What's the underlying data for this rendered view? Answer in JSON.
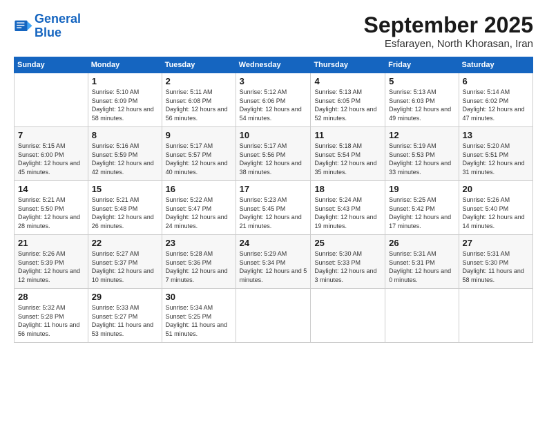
{
  "header": {
    "logo_line1": "General",
    "logo_line2": "Blue",
    "month": "September 2025",
    "location": "Esfarayen, North Khorasan, Iran"
  },
  "days_of_week": [
    "Sunday",
    "Monday",
    "Tuesday",
    "Wednesday",
    "Thursday",
    "Friday",
    "Saturday"
  ],
  "weeks": [
    [
      {
        "num": "",
        "sunrise": "",
        "sunset": "",
        "daylight": ""
      },
      {
        "num": "1",
        "sunrise": "Sunrise: 5:10 AM",
        "sunset": "Sunset: 6:09 PM",
        "daylight": "Daylight: 12 hours and 58 minutes."
      },
      {
        "num": "2",
        "sunrise": "Sunrise: 5:11 AM",
        "sunset": "Sunset: 6:08 PM",
        "daylight": "Daylight: 12 hours and 56 minutes."
      },
      {
        "num": "3",
        "sunrise": "Sunrise: 5:12 AM",
        "sunset": "Sunset: 6:06 PM",
        "daylight": "Daylight: 12 hours and 54 minutes."
      },
      {
        "num": "4",
        "sunrise": "Sunrise: 5:13 AM",
        "sunset": "Sunset: 6:05 PM",
        "daylight": "Daylight: 12 hours and 52 minutes."
      },
      {
        "num": "5",
        "sunrise": "Sunrise: 5:13 AM",
        "sunset": "Sunset: 6:03 PM",
        "daylight": "Daylight: 12 hours and 49 minutes."
      },
      {
        "num": "6",
        "sunrise": "Sunrise: 5:14 AM",
        "sunset": "Sunset: 6:02 PM",
        "daylight": "Daylight: 12 hours and 47 minutes."
      }
    ],
    [
      {
        "num": "7",
        "sunrise": "Sunrise: 5:15 AM",
        "sunset": "Sunset: 6:00 PM",
        "daylight": "Daylight: 12 hours and 45 minutes."
      },
      {
        "num": "8",
        "sunrise": "Sunrise: 5:16 AM",
        "sunset": "Sunset: 5:59 PM",
        "daylight": "Daylight: 12 hours and 42 minutes."
      },
      {
        "num": "9",
        "sunrise": "Sunrise: 5:17 AM",
        "sunset": "Sunset: 5:57 PM",
        "daylight": "Daylight: 12 hours and 40 minutes."
      },
      {
        "num": "10",
        "sunrise": "Sunrise: 5:17 AM",
        "sunset": "Sunset: 5:56 PM",
        "daylight": "Daylight: 12 hours and 38 minutes."
      },
      {
        "num": "11",
        "sunrise": "Sunrise: 5:18 AM",
        "sunset": "Sunset: 5:54 PM",
        "daylight": "Daylight: 12 hours and 35 minutes."
      },
      {
        "num": "12",
        "sunrise": "Sunrise: 5:19 AM",
        "sunset": "Sunset: 5:53 PM",
        "daylight": "Daylight: 12 hours and 33 minutes."
      },
      {
        "num": "13",
        "sunrise": "Sunrise: 5:20 AM",
        "sunset": "Sunset: 5:51 PM",
        "daylight": "Daylight: 12 hours and 31 minutes."
      }
    ],
    [
      {
        "num": "14",
        "sunrise": "Sunrise: 5:21 AM",
        "sunset": "Sunset: 5:50 PM",
        "daylight": "Daylight: 12 hours and 28 minutes."
      },
      {
        "num": "15",
        "sunrise": "Sunrise: 5:21 AM",
        "sunset": "Sunset: 5:48 PM",
        "daylight": "Daylight: 12 hours and 26 minutes."
      },
      {
        "num": "16",
        "sunrise": "Sunrise: 5:22 AM",
        "sunset": "Sunset: 5:47 PM",
        "daylight": "Daylight: 12 hours and 24 minutes."
      },
      {
        "num": "17",
        "sunrise": "Sunrise: 5:23 AM",
        "sunset": "Sunset: 5:45 PM",
        "daylight": "Daylight: 12 hours and 21 minutes."
      },
      {
        "num": "18",
        "sunrise": "Sunrise: 5:24 AM",
        "sunset": "Sunset: 5:43 PM",
        "daylight": "Daylight: 12 hours and 19 minutes."
      },
      {
        "num": "19",
        "sunrise": "Sunrise: 5:25 AM",
        "sunset": "Sunset: 5:42 PM",
        "daylight": "Daylight: 12 hours and 17 minutes."
      },
      {
        "num": "20",
        "sunrise": "Sunrise: 5:26 AM",
        "sunset": "Sunset: 5:40 PM",
        "daylight": "Daylight: 12 hours and 14 minutes."
      }
    ],
    [
      {
        "num": "21",
        "sunrise": "Sunrise: 5:26 AM",
        "sunset": "Sunset: 5:39 PM",
        "daylight": "Daylight: 12 hours and 12 minutes."
      },
      {
        "num": "22",
        "sunrise": "Sunrise: 5:27 AM",
        "sunset": "Sunset: 5:37 PM",
        "daylight": "Daylight: 12 hours and 10 minutes."
      },
      {
        "num": "23",
        "sunrise": "Sunrise: 5:28 AM",
        "sunset": "Sunset: 5:36 PM",
        "daylight": "Daylight: 12 hours and 7 minutes."
      },
      {
        "num": "24",
        "sunrise": "Sunrise: 5:29 AM",
        "sunset": "Sunset: 5:34 PM",
        "daylight": "Daylight: 12 hours and 5 minutes."
      },
      {
        "num": "25",
        "sunrise": "Sunrise: 5:30 AM",
        "sunset": "Sunset: 5:33 PM",
        "daylight": "Daylight: 12 hours and 3 minutes."
      },
      {
        "num": "26",
        "sunrise": "Sunrise: 5:31 AM",
        "sunset": "Sunset: 5:31 PM",
        "daylight": "Daylight: 12 hours and 0 minutes."
      },
      {
        "num": "27",
        "sunrise": "Sunrise: 5:31 AM",
        "sunset": "Sunset: 5:30 PM",
        "daylight": "Daylight: 11 hours and 58 minutes."
      }
    ],
    [
      {
        "num": "28",
        "sunrise": "Sunrise: 5:32 AM",
        "sunset": "Sunset: 5:28 PM",
        "daylight": "Daylight: 11 hours and 56 minutes."
      },
      {
        "num": "29",
        "sunrise": "Sunrise: 5:33 AM",
        "sunset": "Sunset: 5:27 PM",
        "daylight": "Daylight: 11 hours and 53 minutes."
      },
      {
        "num": "30",
        "sunrise": "Sunrise: 5:34 AM",
        "sunset": "Sunset: 5:25 PM",
        "daylight": "Daylight: 11 hours and 51 minutes."
      },
      {
        "num": "",
        "sunrise": "",
        "sunset": "",
        "daylight": ""
      },
      {
        "num": "",
        "sunrise": "",
        "sunset": "",
        "daylight": ""
      },
      {
        "num": "",
        "sunrise": "",
        "sunset": "",
        "daylight": ""
      },
      {
        "num": "",
        "sunrise": "",
        "sunset": "",
        "daylight": ""
      }
    ]
  ]
}
